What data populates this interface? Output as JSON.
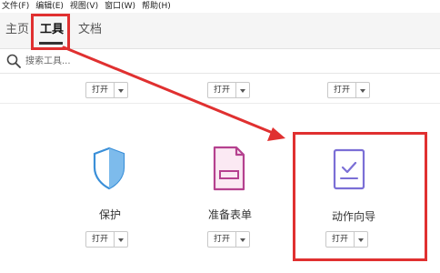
{
  "menubar": {
    "items": [
      "文件(F)",
      "编辑(E)",
      "视图(V)",
      "窗口(W)",
      "帮助(H)"
    ]
  },
  "tabs": [
    {
      "label": "主页"
    },
    {
      "label": "工具"
    },
    {
      "label": "文档"
    }
  ],
  "search": {
    "placeholder": "搜索工具..."
  },
  "top_row_buttons": [
    "打开",
    "打开",
    "打开"
  ],
  "tools": [
    {
      "name": "保护",
      "open_label": "打开",
      "icon": "shield-icon",
      "color": "#3a8fd8"
    },
    {
      "name": "准备表单",
      "open_label": "打开",
      "icon": "form-icon",
      "color": "#b5418f"
    },
    {
      "name": "动作向导",
      "open_label": "打开",
      "icon": "action-wizard-icon",
      "color": "#7b6fd6"
    }
  ],
  "annotation": {
    "color": "#e03030"
  }
}
